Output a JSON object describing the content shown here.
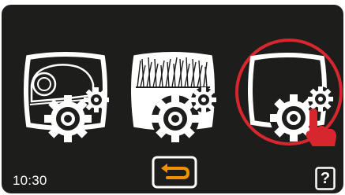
{
  "status": {
    "time": "10:30"
  },
  "menu": {
    "items": [
      {
        "name": "mower-settings",
        "icon": "robot-mower-gear-icon",
        "brand_text": "",
        "selected": false
      },
      {
        "name": "grass-settings",
        "icon": "grass-gear-icon",
        "selected": false
      },
      {
        "name": "general-settings",
        "icon": "blank-frame-gear-icon",
        "selected": true
      }
    ]
  },
  "footer": {
    "back_icon": "return-arrow-icon",
    "help_label": "?"
  },
  "colors": {
    "screen": "#1d1d1b",
    "accent_orange": "#f29100",
    "selection_red": "#d7262e",
    "icon_white": "#ffffff"
  }
}
